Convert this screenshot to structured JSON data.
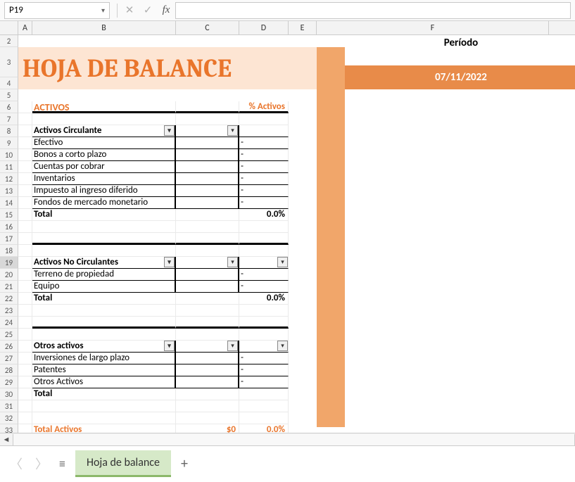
{
  "formula_bar": {
    "cell_ref": "P19",
    "fx_label": "fx"
  },
  "columns": [
    "A",
    "B",
    "C",
    "D",
    "E",
    "F"
  ],
  "rows": [
    "2",
    "3",
    "4",
    "5",
    "6",
    "7",
    "8",
    "9",
    "10",
    "11",
    "12",
    "13",
    "14",
    "15",
    "16",
    "17",
    "18",
    "19",
    "20",
    "21",
    "22",
    "23",
    "24",
    "25",
    "26",
    "27",
    "28",
    "29",
    "30",
    "31",
    "32",
    "33"
  ],
  "title": "HOJA DE BALANCE",
  "periodo": {
    "label": "Período",
    "date": "07/11/2022"
  },
  "sections": {
    "activos_header": "ACTIVOS",
    "pct_header": "% Activos",
    "circulante": {
      "header": "Activos Circulante",
      "rows": [
        "Efectivo",
        "Bonos a corto plazo",
        "Cuentas por cobrar",
        "Inventarios",
        "Impuesto al ingreso diferido",
        "Fondos de mercado monetario"
      ],
      "total_label": "Total",
      "total_pct": "0.0%"
    },
    "no_circulantes": {
      "header": "Activos No Circulantes",
      "rows": [
        "Terreno de propiedad",
        "Equipo"
      ],
      "total_label": "Total",
      "total_pct": "0.0%"
    },
    "otros": {
      "header": "Otros activos",
      "rows": [
        "Inversiones de largo plazo",
        "Patentes",
        "Otros Activos"
      ],
      "total_label": "Total"
    },
    "grand_total": {
      "label": "Total Activos",
      "amount": "$0",
      "pct": "0.0%"
    }
  },
  "dash": "-",
  "tab": {
    "name": "Hoja de balance"
  },
  "chart_data": null
}
